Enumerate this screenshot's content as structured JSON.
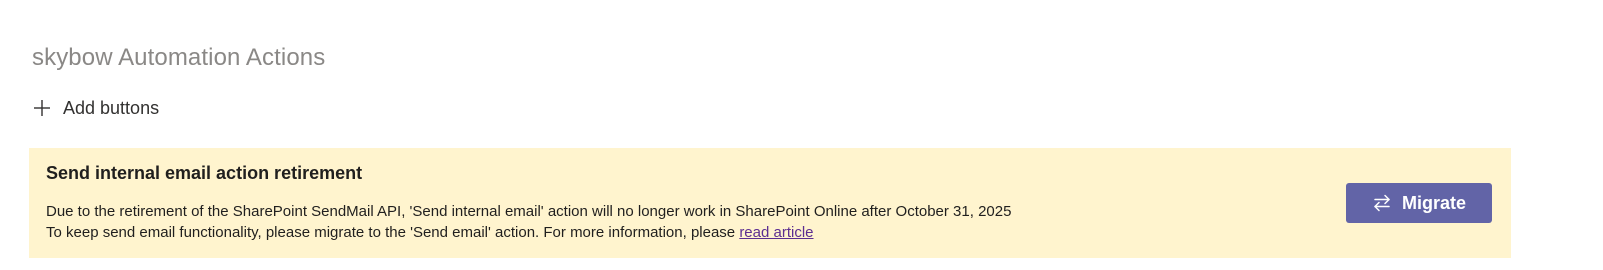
{
  "header": {
    "title": "skybow Automation Actions"
  },
  "toolbar": {
    "add_buttons_label": "Add buttons",
    "add_icon": "plus-icon"
  },
  "notice": {
    "heading": "Send internal email action retirement",
    "line1": "Due to the retirement of the SharePoint SendMail API, 'Send internal email' action will no longer work in SharePoint Online after October 31, 2025",
    "line2_prefix": "To keep send email functionality, please migrate to the 'Send email' action. For more information, please ",
    "link_text": "read article",
    "background_color": "#fff4ce",
    "link_color": "#5c2e91",
    "migrate_button": {
      "label": "Migrate",
      "icon": "swap-arrows-icon",
      "color": "#6264a7"
    }
  }
}
